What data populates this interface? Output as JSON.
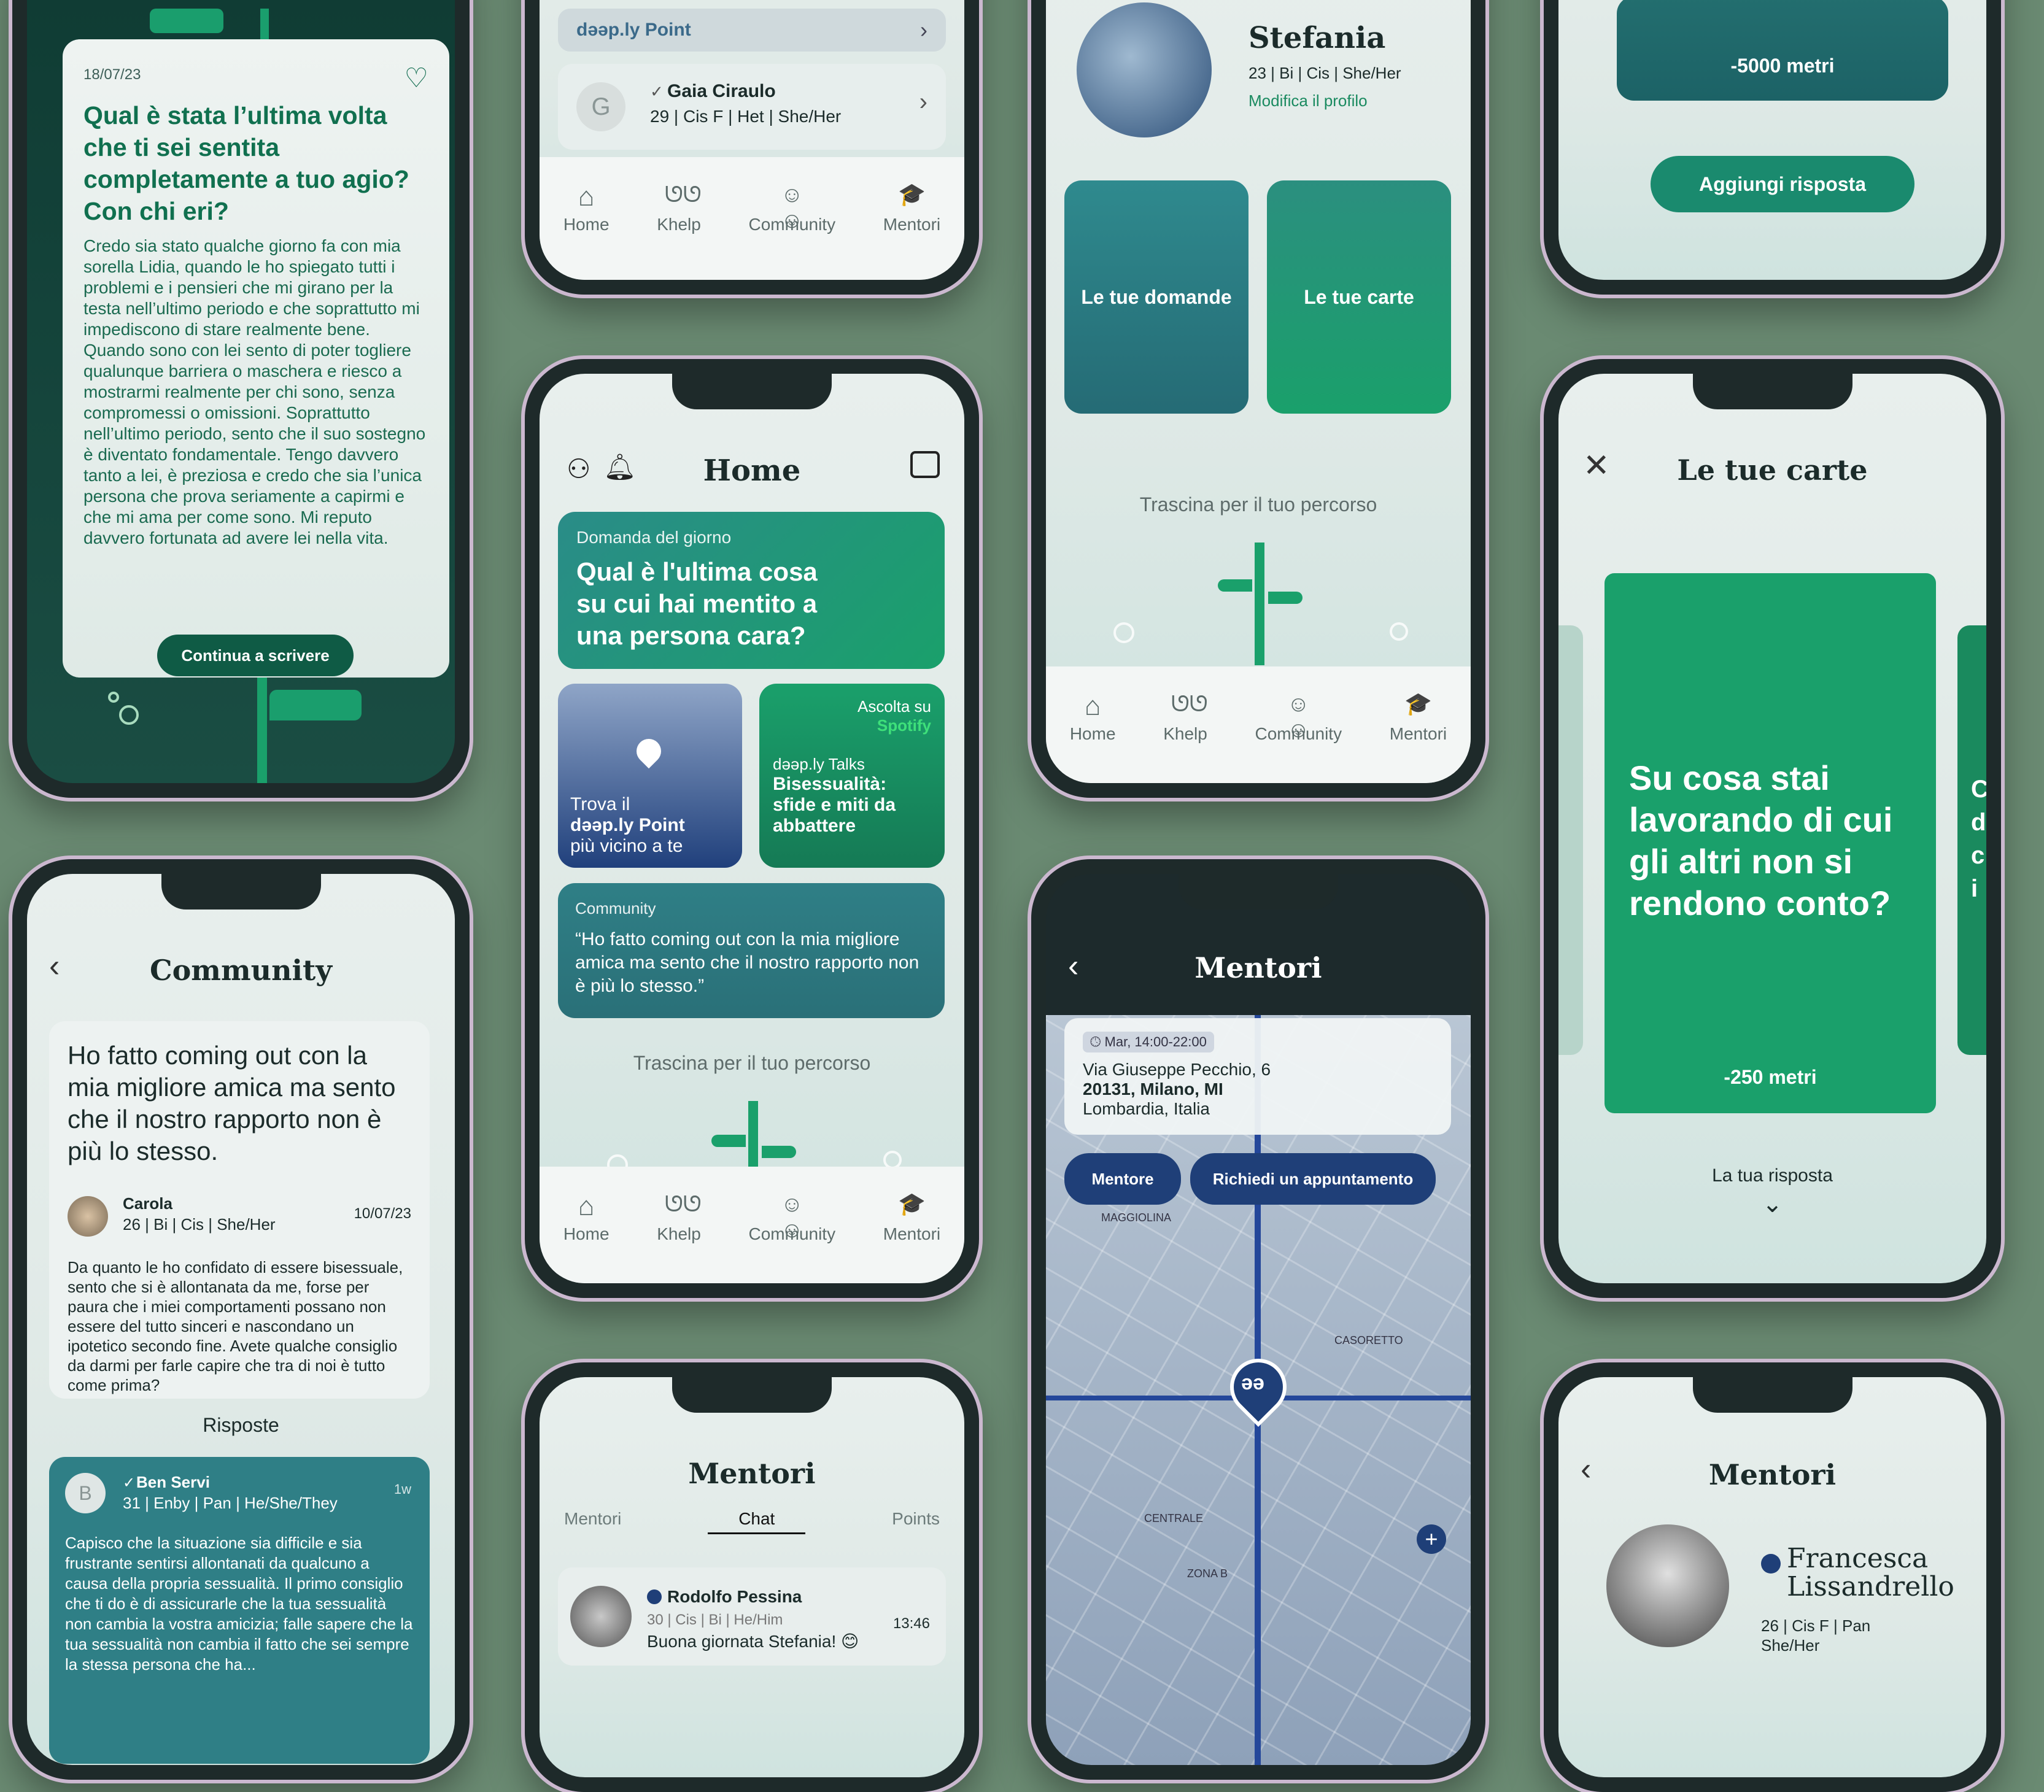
{
  "p1": {
    "date": "18/07/23",
    "question": "Qual è stata l’ultima volta che ti sei sentita completamente a tuo agio? Con chi eri?",
    "answer": "Credo sia stato qualche giorno fa con mia sorella Lidia, quando le ho spiegato tutti i problemi e i pensieri che mi girano per la testa nell’ultimo periodo e che soprattutto mi impediscono di stare realmente bene. Quando sono con lei sento di poter togliere qualunque barriera o maschera e riesco a mostrarmi realmente per chi sono, senza compromessi o omissioni. Soprattutto nell’ultimo periodo, sento che il suo sostegno è diventato fondamentale. Tengo davvero tanto a lei, è preziosa e credo che sia l’unica persona che prova seriamente a capirmi e che mi ama per come sono. Mi reputo davvero fortunata ad avere lei nella vita.",
    "button": "Continua a scrivere"
  },
  "p2": {
    "point_label": "dəəp.ly Point",
    "user_initial": "G",
    "user_name": "Gaia Ciraulo",
    "user_meta": "29 | Cis F | Het | She/Her",
    "tabs": [
      "Home",
      "Khelp",
      "Community",
      "Mentori"
    ]
  },
  "p3": {
    "name": "Stefania",
    "meta": "23 | Bi | Cis | She/Her",
    "edit": "Modifica il profilo",
    "card1": "Le tue domande",
    "card2": "Le tue carte",
    "drag": "Trascina per il tuo percorso",
    "tabs": [
      "Home",
      "Khelp",
      "Community",
      "Mentori"
    ]
  },
  "p4": {
    "distance": "-5000 metri",
    "button": "Aggiungi risposta"
  },
  "home": {
    "title": "Home",
    "dq_label": "Domanda del giorno",
    "dq_text": "Qual è l'ultima cosa su cui hai mentito a una persona cara?",
    "map_line1": "Trova il",
    "map_line2": "dəəp.ly Point",
    "map_line3": "più vicino a te",
    "spotify_label": "Ascolta su",
    "spotify_brand": "Spotify",
    "talks_label": "dəəp.ly Talks",
    "talks_title": "Bisessualità: sfide e miti da abbattere",
    "community_label": "Community",
    "community_quote": "“Ho fatto coming out con la mia migliore amica ma sento che il nostro rapporto non è più lo stesso.”",
    "drag": "Trascina per il tuo percorso",
    "tabs": [
      "Home",
      "Khelp",
      "Community",
      "Mentori"
    ]
  },
  "carte": {
    "title": "Le tue carte",
    "card_text": "Su cosa stai lavorando di cui gli altri non si rendono conto?",
    "distance": "-250 metri",
    "answer_label": "La tua risposta",
    "peek": [
      "C",
      "d",
      "c",
      "i"
    ]
  },
  "community": {
    "title": "Community",
    "post_title": "Ho fatto coming out con la mia migliore amica ma sento che il nostro rapporto non è più lo stesso.",
    "author": "Carola",
    "author_meta": "26 | Bi | Cis | She/Her",
    "date": "10/07/23",
    "body": "Da quanto le ho confidato di essere bisessuale, sento che si è allontanata da me, forse per paura che i miei comportamenti possano non essere del tutto sinceri e nascondano un ipotetico secondo fine. Avete qualche consiglio da darmi per farle capire che tra di noi è tutto come prima?",
    "replies": "Risposte",
    "reply_initial": "B",
    "reply_name": "Ben Servi",
    "reply_meta": "31 | Enby | Pan | He/She/They",
    "reply_time": "1w",
    "reply_body": "Capisco che la situazione sia difficile e sia frustrante sentirsi allontanati da qualcuno a causa della propria sessualità. Il primo consiglio che ti do è di assicurarle che la tua sessualità non cambia la vostra amicizia; falle sapere che la tua sessualità non cambia il fatto che sei sempre la stessa persona che ha..."
  },
  "mentori_map": {
    "title": "Mentori",
    "time": "Mar, 14:00-22:00",
    "addr1": "Via Giuseppe Pecchio, 6",
    "addr2": "20131, Milano, MI",
    "addr3": "Lombardia, Italia",
    "btn_mentor": "Mentore",
    "btn_appt": "Richiedi un appuntamento",
    "pin": "əə",
    "map_labels": [
      "CENTRALE",
      "CASORETTO",
      "MAGGIOLINA",
      "ZONA B"
    ]
  },
  "mentori_chat": {
    "title": "Mentori",
    "tabs": [
      "Mentori",
      "Chat",
      "Points"
    ],
    "name": "Rodolfo Pessina",
    "meta": "30 | Cis | Bi | He/Him",
    "time": "13:46",
    "msg": "Buona giornata Stefania! 😊"
  },
  "mentori_profile": {
    "title": "Mentori",
    "name_first": "Francesca",
    "name_last": "Lissandrello",
    "meta1": "26 | Cis F | Pan",
    "meta2": "She/Her"
  },
  "colors": {
    "green": "#1a9e6d",
    "teal": "#2f7f86",
    "navy": "#1f3f78",
    "bg": "#6a8a72"
  }
}
